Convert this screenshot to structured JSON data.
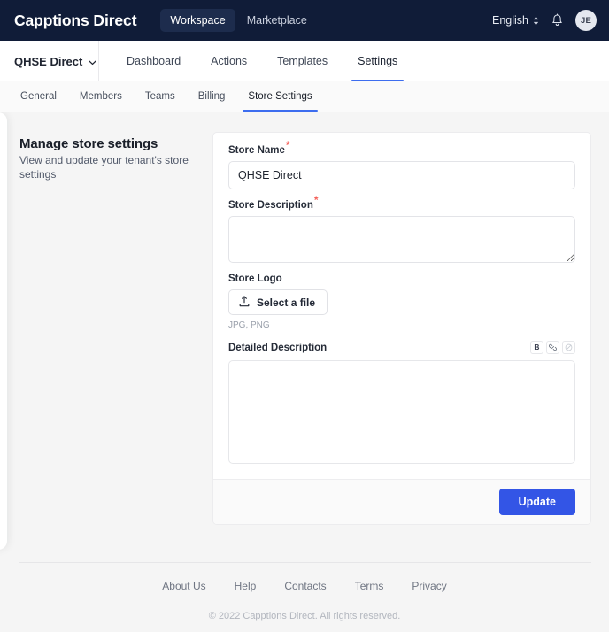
{
  "topbar": {
    "brand": "Capptions Direct",
    "nav": [
      {
        "label": "Workspace",
        "active": true
      },
      {
        "label": "Marketplace",
        "active": false
      }
    ],
    "language": "English",
    "language_icon": "chevron-up-down-icon",
    "bell_icon": "bell-icon",
    "avatar_initials": "JE"
  },
  "primary_nav": {
    "tenant": "QHSE Direct",
    "tenant_icon": "chevron-down-icon",
    "tabs": [
      {
        "label": "Dashboard",
        "active": false
      },
      {
        "label": "Actions",
        "active": false
      },
      {
        "label": "Templates",
        "active": false
      },
      {
        "label": "Settings",
        "active": true
      }
    ]
  },
  "secondary_nav": {
    "tabs": [
      {
        "label": "General",
        "active": false
      },
      {
        "label": "Members",
        "active": false
      },
      {
        "label": "Teams",
        "active": false
      },
      {
        "label": "Billing",
        "active": false
      },
      {
        "label": "Store Settings",
        "active": true
      }
    ]
  },
  "side_intro": {
    "title": "Manage store settings",
    "subtitle": "View and update your tenant's store settings"
  },
  "form": {
    "store_name": {
      "label": "Store Name",
      "required_marker": "*",
      "value": "QHSE Direct",
      "placeholder": ""
    },
    "store_description": {
      "label": "Store Description",
      "required_marker": "*",
      "value": "",
      "placeholder": ""
    },
    "store_logo": {
      "label": "Store Logo",
      "button_label": "Select a file",
      "button_icon": "upload-icon",
      "hint": "JPG, PNG"
    },
    "detailed_description": {
      "label": "Detailed Description",
      "value": "",
      "placeholder": "",
      "toolbar": [
        {
          "name": "bold-icon",
          "label": "B",
          "disabled": false
        },
        {
          "name": "link-icon",
          "label": "",
          "disabled": false
        },
        {
          "name": "unlink-icon",
          "label": "",
          "disabled": true
        }
      ]
    },
    "submit_label": "Update"
  },
  "footer": {
    "links": [
      "About Us",
      "Help",
      "Contacts",
      "Terms",
      "Privacy"
    ],
    "copyright": "© 2022 Capptions Direct. All rights reserved."
  },
  "colors": {
    "topbar_bg": "#101c38",
    "accent": "#3d6def",
    "primary_button": "#3355e6",
    "required": "#f4615a"
  }
}
